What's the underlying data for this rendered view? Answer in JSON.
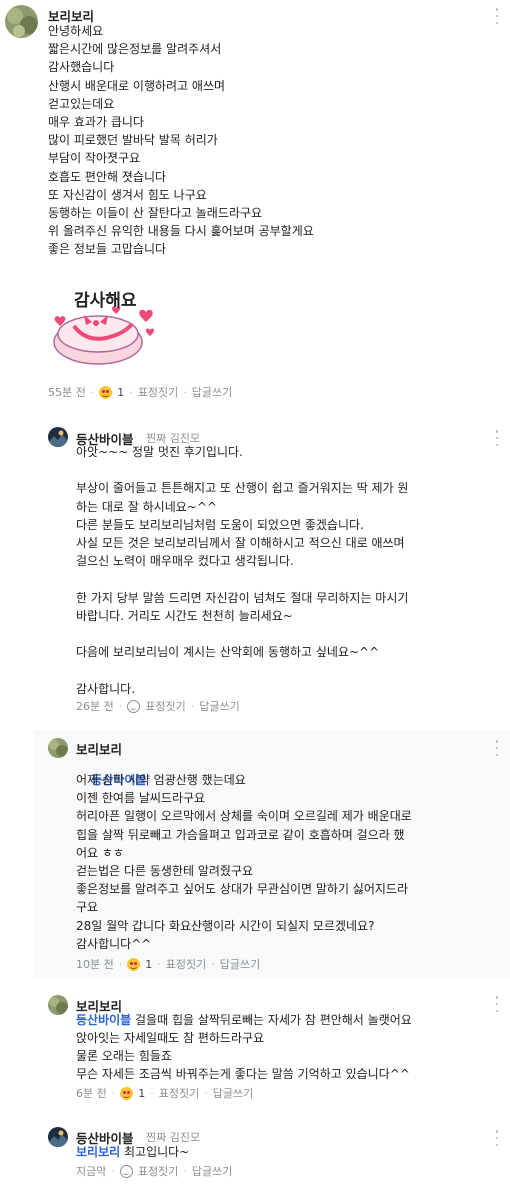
{
  "comments": [
    {
      "author": "보리보리",
      "lines": [
        "안녕하세요",
        "짧은시간에 많은정보를 알려주셔서",
        "감사했습니다",
        "산행시 배운대로 이행하려고 애쓰며",
        "걷고있는데요",
        "매우 효과가 큽니다",
        "많이 피로했던 발바닥 발목 허리가",
        "부담이 작아졋구요",
        "호흡도 편안해 졋습니다",
        "또 자신감이 생겨서 힘도 나구요",
        "동행하는 이들이 산 잘탄다고 놀래드라구요",
        "위 올려주신 유익한 내용들 다시 훑어보며 공부할게요",
        "좋은 정보들 고맙습니다"
      ],
      "sticker_text": "감사해요",
      "time": "55분 전",
      "reaction_count": "1",
      "emote_label": "표정짓기",
      "reply_label": "답글쓰기"
    },
    {
      "author": "등산바이블",
      "badge": "찐짜 김진모",
      "lines": [
        "아앗~~~ 정말 멋진 후기입니다.",
        "",
        "부상이 줄어들고 튼튼해지고 또 산행이 쉽고 즐거워지는 딱 제가 원",
        "하는 대로 잘 하시네요~^^",
        "다른 분들도 보리보리님처럼 도움이 되었으면 좋겠습니다.",
        "사실 모든 것은 보리보리님께서 잘 이해하시고 적으신 대로 애쓰며",
        "걸으신 노력이 매우매우 컸다고 생각됩니다.",
        "",
        "한 가지 당부 말씀 드리면 자신감이 넘쳐도 절대 무리하지는 마시기",
        "바랍니다. 거리도 시간도 천천히 늘리세요~",
        "",
        "다음에 보리보리님이 계시는 산악회에 동행하고 싶네요~^^",
        "",
        "감사합니다."
      ],
      "time": "26분 전",
      "emote_label": "표정짓기",
      "reply_label": "답글쓰기"
    },
    {
      "author": "보리보리",
      "mention": "등산바이블",
      "lines": [
        "어제 송학 시약 엄광산행 했는데요",
        "이젠 한여름 날씨드라구요",
        "허리아픈 일행이 오르막에서 상체를 숙이며 오르길레 제가 배운대로",
        "힙을 살짝 뒤로빼고 가슴을펴고 입과코로 같이 호흡하며 걸으라 했",
        "어요 ㅎㅎ",
        "걷는법은 다른 동생한테 알려줬구요",
        "좋은정보를 알려주고 싶어도 상대가 무관심이면 말하기 싫어지드라",
        "구요",
        "28일 월악 갑니다 화요산행이라 시간이 되실지 모르겠네요?",
        "감사합니다^^"
      ],
      "time": "10분 전",
      "reaction_count": "1",
      "emote_label": "표정짓기",
      "reply_label": "답글쓰기"
    },
    {
      "author": "보리보리",
      "mention": "등산바이블",
      "first_line_rest": " 걸을때 힙을 살짝뒤로빼는 자세가 참 편안해서 놀랫어요",
      "lines": [
        "앉아잇는 자세일때도 참 편하드라구요",
        "물론 오래는 힘들죠",
        "무슨 자세든 조금씩 바꿔주는게 좋다는 말씀 기억하고 있습니다^^"
      ],
      "time": "6분 전",
      "reaction_count": "1",
      "emote_label": "표정짓기",
      "reply_label": "답글쓰기"
    },
    {
      "author": "등산바이블",
      "badge": "찐짜 김진모",
      "mention": "보리보리",
      "first_line_rest": " 최고입니다~",
      "time": "지금막",
      "emote_label": "표정짓기",
      "reply_label": "답글쓰기"
    }
  ],
  "colors": {
    "mention": "#2a63d4",
    "meta": "#8a8f96",
    "reply_bg": "#f8f9fa",
    "heart": "#ee4a78"
  }
}
